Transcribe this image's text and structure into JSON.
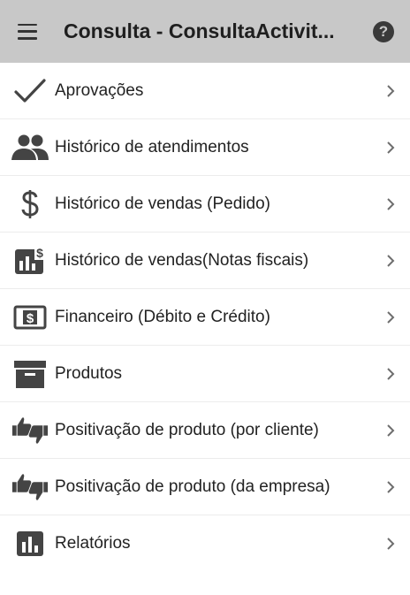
{
  "appbar": {
    "title": "Consulta - ConsultaActivit...",
    "menu_icon": "hamburger-menu-icon",
    "help_icon": "help-icon",
    "help_glyph": "?"
  },
  "menu": {
    "items": [
      {
        "label": "Aprovações",
        "icon": "checkmark-icon"
      },
      {
        "label": "Histórico de atendimentos",
        "icon": "people-icon"
      },
      {
        "label": "Histórico de vendas (Pedido)",
        "icon": "dollar-icon"
      },
      {
        "label": "Histórico de vendas(Notas fiscais)",
        "icon": "invoice-chart-icon"
      },
      {
        "label": "Financeiro (Débito e Crédito)",
        "icon": "money-box-icon"
      },
      {
        "label": "Produtos",
        "icon": "archive-box-icon"
      },
      {
        "label": "Positivação de produto (por cliente)",
        "icon": "thumbs-up-down-icon"
      },
      {
        "label": "Positivação de produto (da empresa)",
        "icon": "thumbs-up-down-icon"
      },
      {
        "label": "Relatórios",
        "icon": "bar-chart-icon"
      }
    ]
  },
  "colors": {
    "appbar_bg": "#c8c8c8",
    "icon": "#444444",
    "chevron": "#6e6e6e"
  }
}
